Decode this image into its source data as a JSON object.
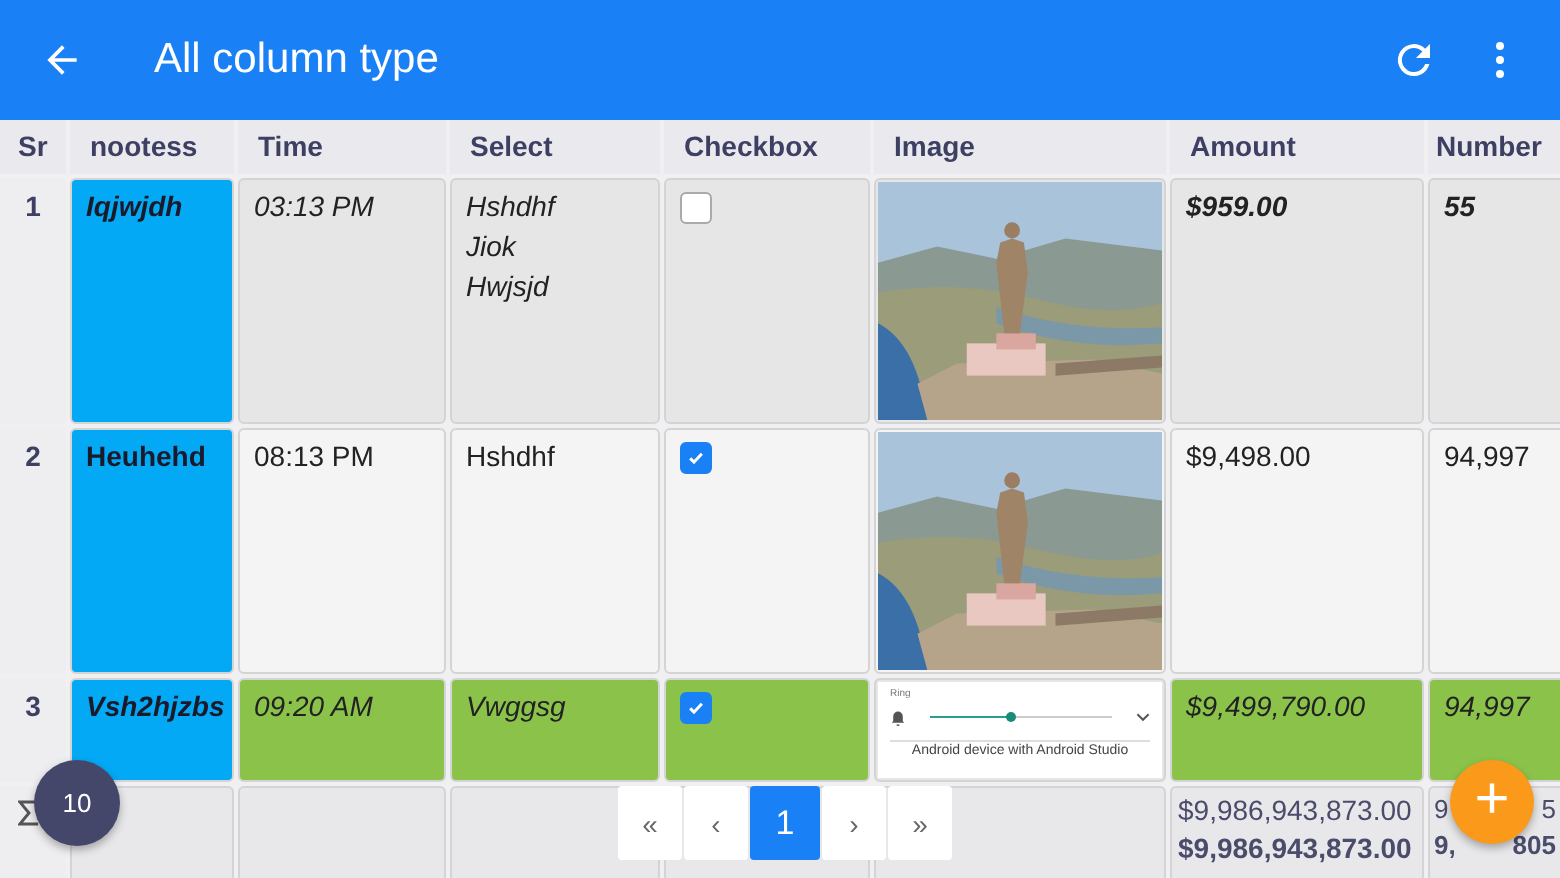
{
  "app_bar": {
    "title": "All column type"
  },
  "table": {
    "columns": [
      {
        "label": "Sr",
        "kind": "sr"
      },
      {
        "label": "nootess",
        "kind": "name"
      },
      {
        "label": "Time",
        "kind": "text"
      },
      {
        "label": "Select",
        "kind": "select"
      },
      {
        "label": "Checkbox",
        "kind": "checkbox"
      },
      {
        "label": "Image"
      },
      {
        "label": "Amount",
        "kind": "emph"
      },
      {
        "label": "Number",
        "kind": "emph"
      }
    ],
    "rows": [
      {
        "sr": "1",
        "italic": true,
        "bold": true,
        "highlighted": false,
        "name": "Iqjwjdh",
        "time": "03:13 PM",
        "select": [
          "Hshdhf",
          "Jiok",
          "Hwjsjd"
        ],
        "checked": false,
        "image": {
          "kind": "picture"
        },
        "amount": "$959.00",
        "number": "55"
      },
      {
        "sr": "2",
        "italic": false,
        "bold": false,
        "highlighted": false,
        "name": "Heuhehd",
        "time": "08:13 PM",
        "select": [
          "Hshdhf"
        ],
        "checked": true,
        "image": {
          "kind": "picture"
        },
        "amount": "$9,498.00",
        "number": "94,997"
      },
      {
        "sr": "3",
        "italic": true,
        "bold": false,
        "highlighted": true,
        "name": "Vsh2hjzbs",
        "time": "09:20 AM",
        "select": [
          "Vwggsg"
        ],
        "checked": true,
        "image": {
          "kind": "screenshot",
          "label": "Ring",
          "level": 0.45,
          "caption": "Android device with Android Studio"
        },
        "amount": "$9,499,790.00",
        "number": "94,997"
      }
    ],
    "footer": {
      "amount": [
        "$9,986,943,873.00",
        "$9,986,943,873.00"
      ],
      "number": [
        {
          "start": "9",
          "end": "5",
          "bold": false
        },
        {
          "start": "9,",
          "end": "805",
          "bold": true
        }
      ]
    }
  },
  "pagination": {
    "first": "«",
    "prev": "‹",
    "pages": [
      {
        "label": "1",
        "selected": true
      }
    ],
    "next": "›",
    "last": "»"
  },
  "count_badge": "10",
  "fab": "+"
}
